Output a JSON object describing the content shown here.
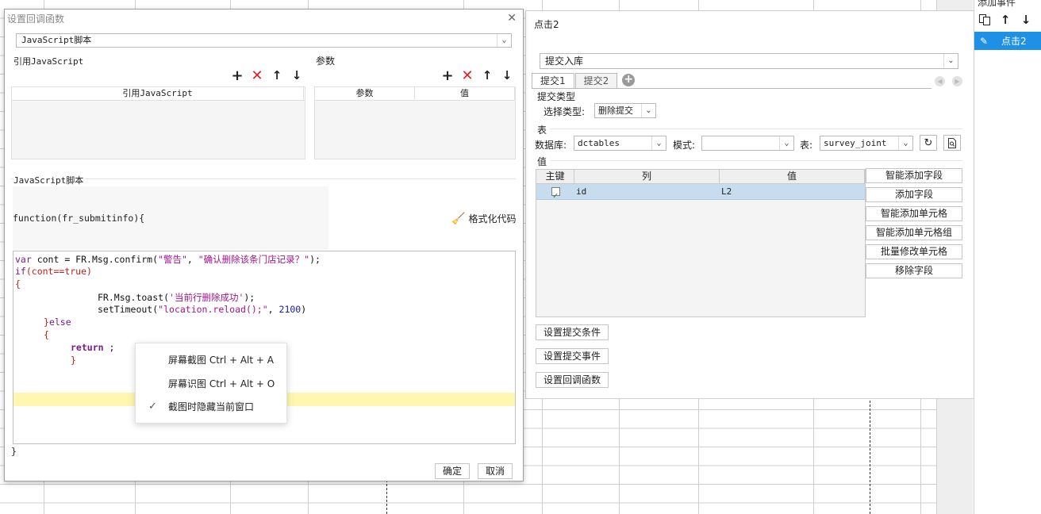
{
  "dialog": {
    "title": "设置回调函数",
    "type_select": "JavaScript脚本",
    "ref_js_label": "引用JavaScript",
    "params_label": "参数",
    "ref_js_col": "引用JavaScript",
    "param_col": "参数",
    "value_col": "值",
    "script_label": "JavaScript脚本",
    "func_header": "function(fr_submitinfo){",
    "format_code": "格式化代码",
    "closing_brace": "}",
    "ok": "确定",
    "cancel": "取消",
    "code": {
      "l1_kw": "var",
      "l1_a": " cont = FR.Msg.confirm(",
      "l1_s1": "\"警告\"",
      "l1_b": ", ",
      "l1_s2": "\"确认删除该条门店记录？\"",
      "l1_c": ");",
      "l2_kw": "if",
      "l2_a": "(cont==",
      "l2_kw2": "true",
      "l2_b": ")",
      "l3": "{",
      "l4_a": "        FR.Msg.toast(",
      "l4_s": "'当前行删除成功'",
      "l4_b": ");",
      "l5_a": "        setTimeout(",
      "l5_s": "\"location.reload();\"",
      "l5_b": ", ",
      "l5_n": "2100",
      "l5_c": ")",
      "l6_a": "   }",
      "l6_kw": "else",
      "l7": "   {",
      "l8_kw": "return",
      "l8_b": " ;",
      "l9": "}"
    }
  },
  "context_menu": {
    "item1": "屏幕截图 Ctrl + Alt + A",
    "item2": "屏幕识图 Ctrl + Alt + O",
    "item3": "截图时隐藏当前窗口",
    "item3_checked": true
  },
  "panel": {
    "title": "点击2",
    "action_select": "提交入库",
    "tabs": [
      "提交1",
      "提交2"
    ],
    "submit_type_label": "提交类型",
    "choose_type_label": "选择类型:",
    "choose_type_value": "删除提交",
    "table_label": "表",
    "db_label": "数据库:",
    "db_value": "dctables",
    "mode_label": "模式:",
    "mode_value": "",
    "table_field_label": "表:",
    "table_value": "survey_joint",
    "value_label": "值",
    "columns": [
      "主键",
      "列",
      "值"
    ],
    "rows": [
      {
        "key": true,
        "col": "id",
        "val": "L2"
      }
    ],
    "side_buttons": [
      "智能添加字段",
      "添加字段",
      "智能添加单元格",
      "智能添加单元格组",
      "批量修改单元格",
      "移除字段"
    ],
    "action_buttons": [
      "设置提交条件",
      "设置提交事件",
      "设置回调函数"
    ]
  },
  "right": {
    "title": "添加事件",
    "item_label": "点击2"
  },
  "colors": {
    "accent": "#1e90e6",
    "row_selected": "#c7dcee",
    "highlight_line": "#fff7b0",
    "delete_red": "#e02020"
  }
}
